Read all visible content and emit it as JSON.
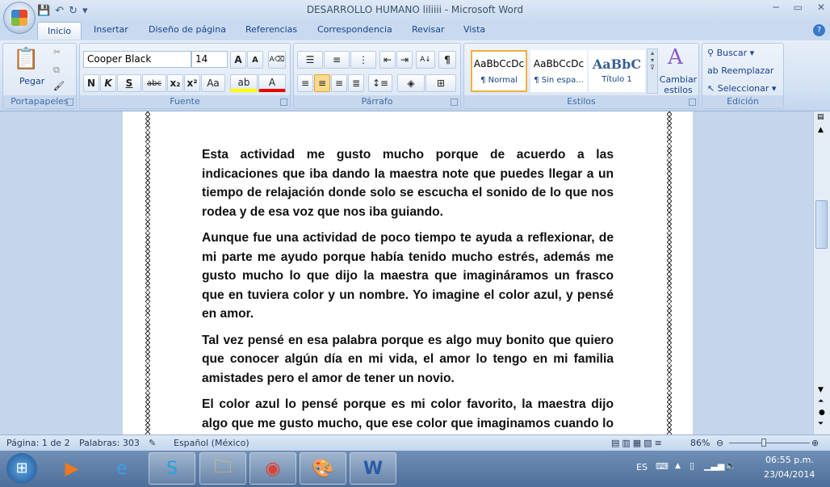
{
  "window": {
    "title": "DESARROLLO HUMANO liliiii - Microsoft Word",
    "qat": [
      "save",
      "undo",
      "redo",
      "customize"
    ],
    "controls": [
      "minimize",
      "maximize",
      "close"
    ]
  },
  "tabs": [
    "Inicio",
    "Insertar",
    "Diseño de página",
    "Referencias",
    "Correspondencia",
    "Revisar",
    "Vista"
  ],
  "ribbon": {
    "clipboard": {
      "label": "Portapapeles",
      "paste": "Pegar"
    },
    "font": {
      "label": "Fuente",
      "name": "Cooper Black",
      "size": "14",
      "bold": "N",
      "italic": "K",
      "underline": "S",
      "strike": "abc",
      "sub": "x₂",
      "sup": "x²",
      "case": "Aa",
      "grow": "A",
      "shrink": "A"
    },
    "paragraph": {
      "label": "Párrafo"
    },
    "styles": {
      "label": "Estilos",
      "items": [
        {
          "preview": "AaBbCcDc",
          "name": "¶ Normal"
        },
        {
          "preview": "AaBbCcDc",
          "name": "¶ Sin espa..."
        },
        {
          "preview": "AaBbC",
          "name": "Título 1"
        }
      ],
      "change": "Cambiar estilos"
    },
    "editing": {
      "label": "Edición",
      "find": "Buscar",
      "replace": "Reemplazar",
      "select": "Seleccionar"
    }
  },
  "document": {
    "paragraphs": [
      "Esta actividad me gusto mucho porque de acuerdo a las indicaciones que iba dando la maestra note que puedes llegar a un tiempo de relajación donde solo se escucha el sonido de lo que nos rodea y de esa voz que nos iba guiando.",
      "Aunque fue una actividad de poco tiempo te ayuda a reflexionar, de mi parte me ayudo porque había tenido mucho estrés, además me gusto mucho lo que dijo la maestra que imagináramos un frasco que en tuviera color y un nombre. Yo imagine el color azul, y pensé en amor.",
      "Tal vez pensé en esa palabra porque es algo muy bonito que quiero que conocer algún día en mi vida, el amor lo tengo en mi familia amistades pero el amor de tener un novio.",
      "El color azul lo pensé porque es mi color favorito, la maestra dijo algo que me gusto mucho, que ese color que imaginamos cuando lo lleguemos a ver en algún lugar o lo lleguemos a oler o sentir"
    ]
  },
  "status": {
    "page": "Página: 1 de 2",
    "words": "Palabras: 303",
    "language": "Español (México)",
    "zoom": "86%",
    "zoom_value": 86
  },
  "taskbar": {
    "lang": "ES",
    "time": "06:55 p.m.",
    "date": "23/04/2014"
  }
}
